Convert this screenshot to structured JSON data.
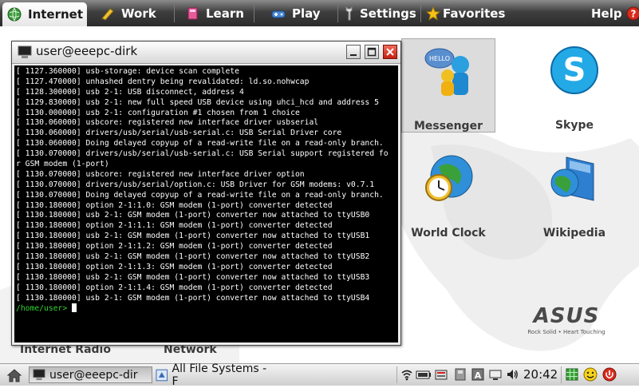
{
  "tabs": [
    {
      "label": "Internet",
      "icon": "globe-icon",
      "active": true
    },
    {
      "label": "Work",
      "icon": "pen-icon",
      "active": false
    },
    {
      "label": "Learn",
      "icon": "book-icon",
      "active": false
    },
    {
      "label": "Play",
      "icon": "gamepad-icon",
      "active": false
    },
    {
      "label": "Settings",
      "icon": "wrench-icon",
      "active": false
    },
    {
      "label": "Favorites",
      "icon": "star-icon",
      "active": false
    }
  ],
  "help": {
    "label": "Help",
    "icon": "question-icon"
  },
  "apps": [
    {
      "label": "Messenger",
      "icon": "messenger-icon",
      "selected": true,
      "bubble": "HELLO"
    },
    {
      "label": "Skype",
      "icon": "skype-icon",
      "selected": false
    },
    {
      "label": "World Clock",
      "icon": "world-clock-icon",
      "selected": false
    },
    {
      "label": "Wikipedia",
      "icon": "wikipedia-icon",
      "selected": false
    }
  ],
  "partially_hidden_labels": [
    "Internet Radio",
    "Network"
  ],
  "brand": {
    "logo": "ASUS",
    "tagline": "Rock Solid • Heart Touching"
  },
  "terminal": {
    "title": "user@eeepc-dirk",
    "lines": [
      "[ 1127.360000] usb-storage: device scan complete",
      "[ 1127.470000] unhashed dentry being revalidated: ld.so.nohwcap",
      "[ 1128.300000] usb 2-1: USB disconnect, address 4",
      "[ 1129.830000] usb 2-1: new full speed USB device using uhci_hcd and address 5",
      "[ 1130.000000] usb 2-1: configuration #1 chosen from 1 choice",
      "[ 1130.060000] usbcore: registered new interface driver usbserial",
      "[ 1130.060000] drivers/usb/serial/usb-serial.c: USB Serial Driver core",
      "[ 1130.060000] Doing delayed copyup of a read-write file on a read-only branch.",
      "[ 1130.070000] drivers/usb/serial/usb-serial.c: USB Serial support registered fo",
      "r GSM modem (1-port)",
      "[ 1130.070000] usbcore: registered new interface driver option",
      "[ 1130.070000] drivers/usb/serial/option.c: USB Driver for GSM modems: v0.7.1",
      "[ 1130.070000] Doing delayed copyup of a read-write file on a read-only branch.",
      "[ 1130.180000] option 2-1:1.0: GSM modem (1-port) converter detected",
      "[ 1130.180000] usb 2-1: GSM modem (1-port) converter now attached to ttyUSB0",
      "[ 1130.180000] option 2-1:1.1: GSM modem (1-port) converter detected",
      "[ 1130.180000] usb 2-1: GSM modem (1-port) converter now attached to ttyUSB1",
      "[ 1130.180000] option 2-1:1.2: GSM modem (1-port) converter detected",
      "[ 1130.180000] usb 2-1: GSM modem (1-port) converter now attached to ttyUSB2",
      "[ 1130.180000] option 2-1:1.3: GSM modem (1-port) converter detected",
      "[ 1130.180000] usb 2-1: GSM modem (1-port) converter now attached to ttyUSB3",
      "[ 1130.180000] option 2-1:1.4: GSM modem (1-port) converter detected",
      "[ 1130.180000] usb 2-1: GSM modem (1-port) converter now attached to ttyUSB4"
    ],
    "prompt": "/home/user>"
  },
  "taskbar": {
    "tasks": [
      {
        "label": "user@eeepc-dir",
        "icon": "terminal-icon",
        "active": true
      },
      {
        "label": "All File Systems - F",
        "icon": "file-manager-icon",
        "active": false
      }
    ],
    "tray_icons": [
      "network-icon",
      "battery-icon",
      "keyboard-icon",
      "removable-disk-icon",
      "input-method-icon",
      "display-icon",
      "volume-icon"
    ],
    "clock": "20:42",
    "end_icons": [
      "grid-icon",
      "smiley-icon",
      "power-icon"
    ]
  },
  "colors": {
    "tabbar": "#3e3e3e",
    "terminal_bg": "#000000",
    "prompt": "#32d632",
    "accent_red": "#d92a1c"
  }
}
